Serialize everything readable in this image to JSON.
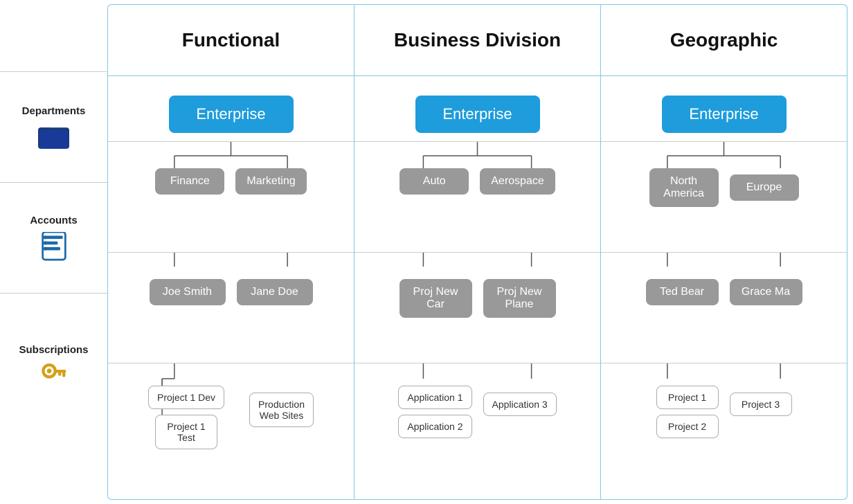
{
  "headers": {
    "functional": "Functional",
    "business_division": "Business Division",
    "geographic": "Geographic"
  },
  "row_labels": {
    "departments": "Departments",
    "accounts": "Accounts",
    "subscriptions": "Subscriptions"
  },
  "functional": {
    "enterprise": "Enterprise",
    "departments": [
      "Finance",
      "Marketing"
    ],
    "accounts": [
      {
        "name": "Joe Smith",
        "parent": "Finance"
      },
      {
        "name": "Jane Doe",
        "parent": "Marketing"
      }
    ],
    "subscriptions": {
      "Joe Smith": [
        "Project 1 Dev",
        "Project 1 Test"
      ],
      "Jane Doe": [
        "Production Web Sites"
      ]
    }
  },
  "business_division": {
    "enterprise": "Enterprise",
    "departments": [
      "Auto",
      "Aerospace"
    ],
    "accounts": [
      {
        "name": "Proj New Car",
        "parent": "Auto"
      },
      {
        "name": "Proj New Plane",
        "parent": "Aerospace"
      }
    ],
    "subscriptions": {
      "Proj New Car": [
        "Application 1",
        "Application 2"
      ],
      "Proj New Plane": [
        "Application 3"
      ]
    }
  },
  "geographic": {
    "enterprise": "Enterprise",
    "departments": [
      "North America",
      "Europe"
    ],
    "accounts": [
      {
        "name": "Ted Bear",
        "parent": "North America"
      },
      {
        "name": "Grace Ma",
        "parent": "Europe"
      }
    ],
    "subscriptions": {
      "Ted Bear": [
        "Project 1",
        "Project 2"
      ],
      "Grace Ma": [
        "Project 3"
      ]
    }
  }
}
